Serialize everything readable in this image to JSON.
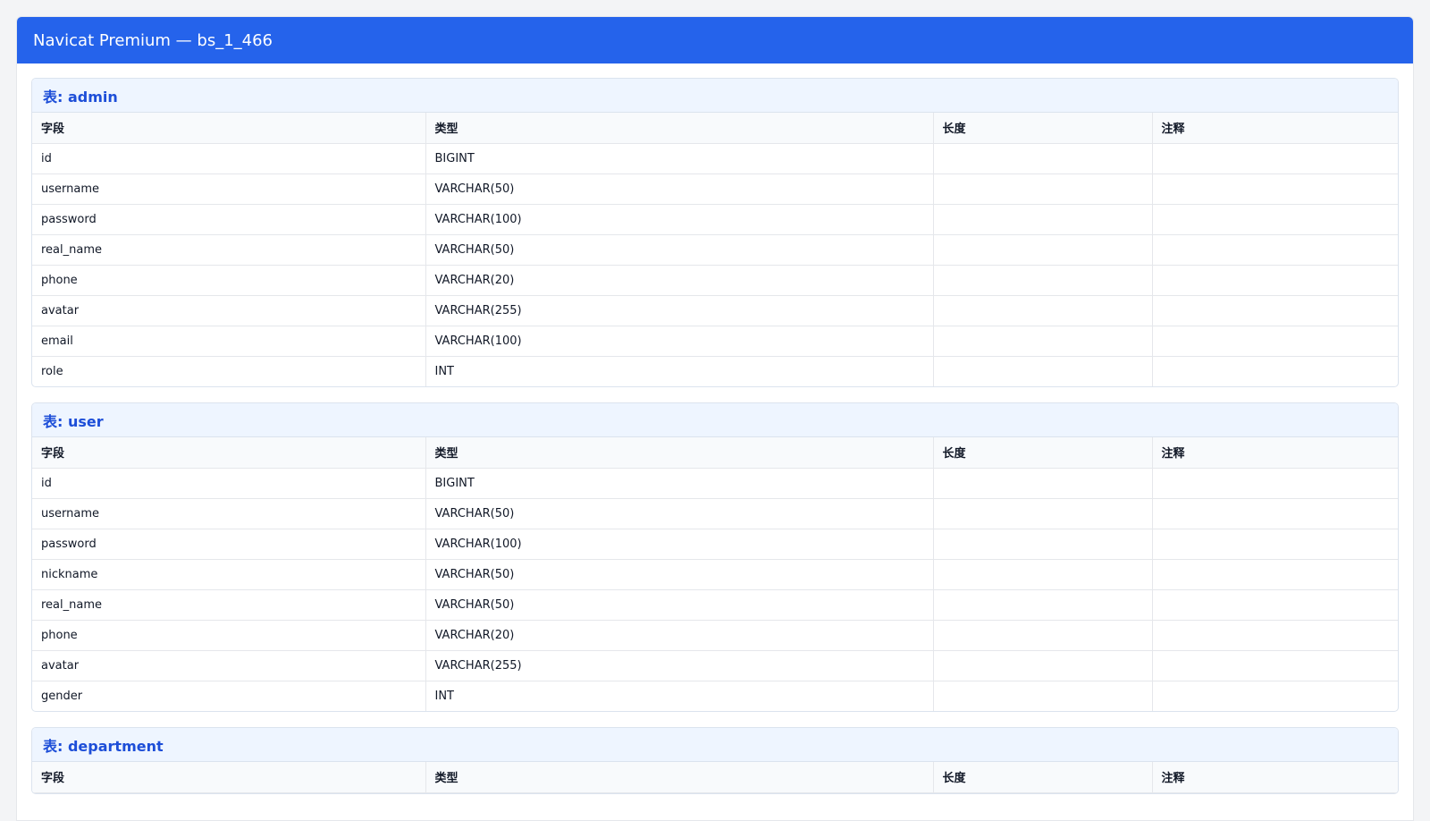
{
  "app": {
    "title": "Navicat Premium — bs_1_466"
  },
  "columns": [
    "字段",
    "类型",
    "长度",
    "注释"
  ],
  "tables": [
    {
      "name": "表: admin",
      "rows": [
        {
          "field": "id",
          "type": "BIGINT",
          "length": "",
          "comment": ""
        },
        {
          "field": "username",
          "type": "VARCHAR(50)",
          "length": "",
          "comment": ""
        },
        {
          "field": "password",
          "type": "VARCHAR(100)",
          "length": "",
          "comment": ""
        },
        {
          "field": "real_name",
          "type": "VARCHAR(50)",
          "length": "",
          "comment": ""
        },
        {
          "field": "phone",
          "type": "VARCHAR(20)",
          "length": "",
          "comment": ""
        },
        {
          "field": "avatar",
          "type": "VARCHAR(255)",
          "length": "",
          "comment": ""
        },
        {
          "field": "email",
          "type": "VARCHAR(100)",
          "length": "",
          "comment": ""
        },
        {
          "field": "role",
          "type": "INT",
          "length": "",
          "comment": ""
        }
      ]
    },
    {
      "name": "表: user",
      "rows": [
        {
          "field": "id",
          "type": "BIGINT",
          "length": "",
          "comment": ""
        },
        {
          "field": "username",
          "type": "VARCHAR(50)",
          "length": "",
          "comment": ""
        },
        {
          "field": "password",
          "type": "VARCHAR(100)",
          "length": "",
          "comment": ""
        },
        {
          "field": "nickname",
          "type": "VARCHAR(50)",
          "length": "",
          "comment": ""
        },
        {
          "field": "real_name",
          "type": "VARCHAR(50)",
          "length": "",
          "comment": ""
        },
        {
          "field": "phone",
          "type": "VARCHAR(20)",
          "length": "",
          "comment": ""
        },
        {
          "field": "avatar",
          "type": "VARCHAR(255)",
          "length": "",
          "comment": ""
        },
        {
          "field": "gender",
          "type": "INT",
          "length": "",
          "comment": ""
        }
      ]
    },
    {
      "name": "表: department",
      "rows": []
    }
  ],
  "colors": {
    "titlebar": "#2563eb",
    "table_header_text": "#1d4ed8",
    "table_header_bg": "#eef5ff"
  }
}
